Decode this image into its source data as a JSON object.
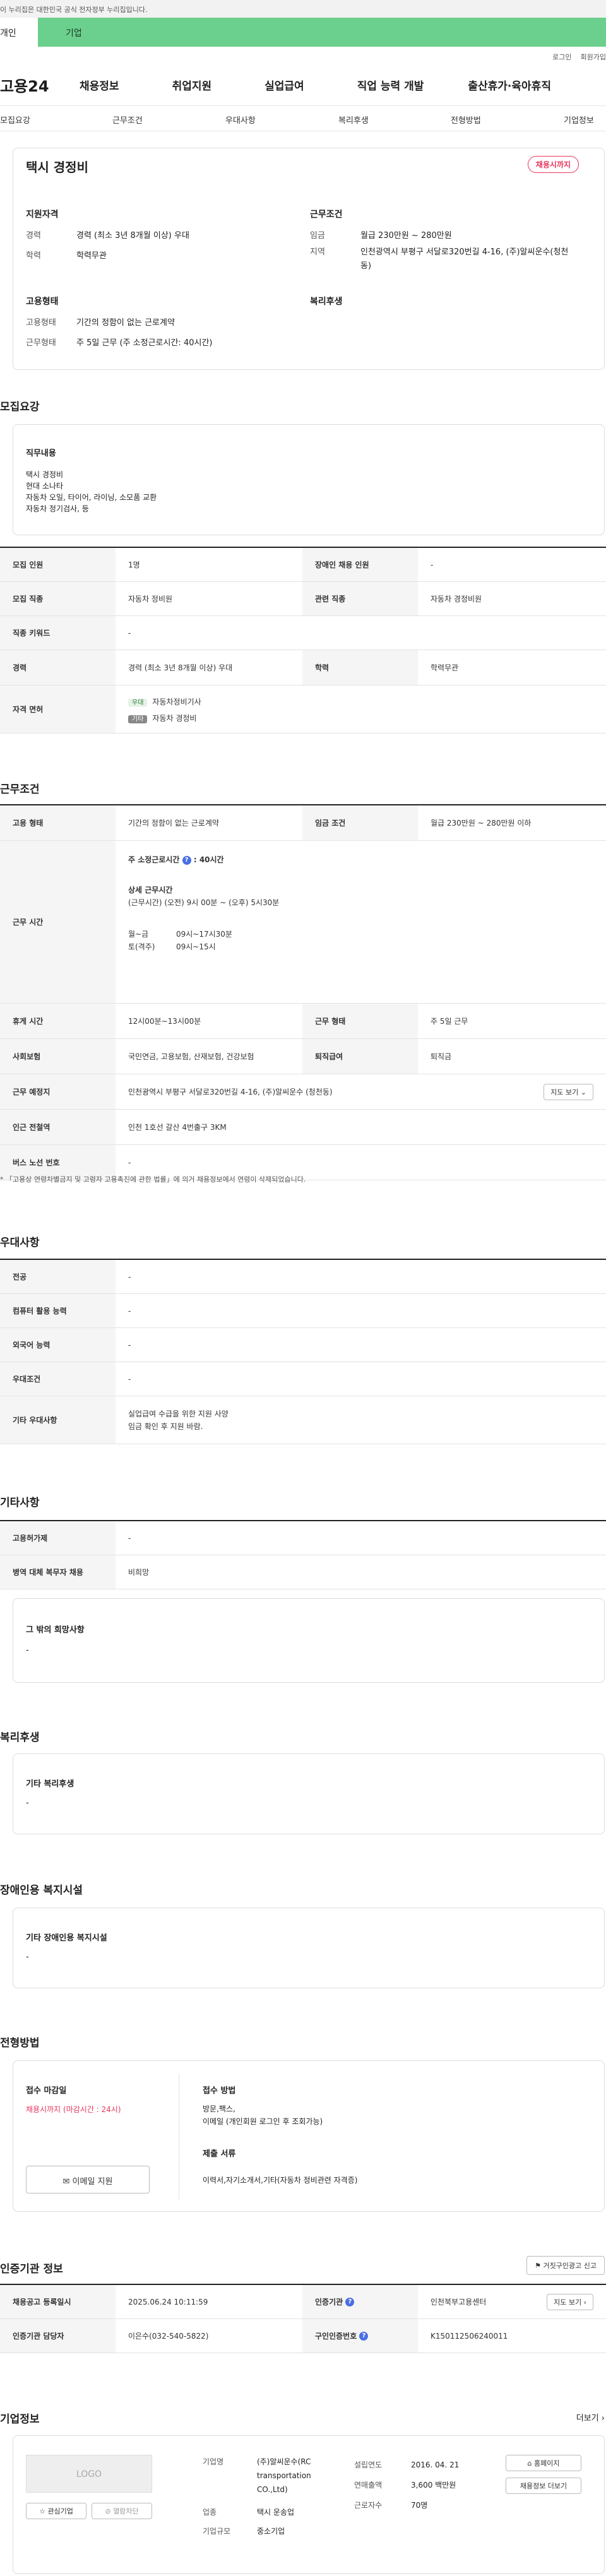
{
  "top": {
    "gov_notice": "이 누리집은 대한민국 공식 전자정부 누리집입니다.",
    "tab_personal": "개인",
    "tab_company": "기업"
  },
  "util": {
    "login": "로그인",
    "join": "회원가입"
  },
  "gnb": {
    "logo": "고용24",
    "menu": [
      "채용정보",
      "취업지원",
      "실업급여",
      "직업 능력 개발",
      "출산휴가·육아휴직"
    ]
  },
  "snb": [
    "모집요강",
    "근무조건",
    "우대사항",
    "복리후생",
    "전형방법",
    "기업정보"
  ],
  "summary": {
    "title": "택시 경정비",
    "status": "채용시까지",
    "qual_head": "지원자격",
    "career_k": "경력",
    "career_v": "경력 (최소 3년 8개월 이상) 우대",
    "edu_k": "학력",
    "edu_v": "학력무관",
    "cond_head": "근무조건",
    "wage_k": "임금",
    "wage_v": "월급 230만원 ~ 280만원",
    "region_k": "지역",
    "region_v": "인천광역시 부평구 서달로320번길 4-16, (주)알씨운수(청천동)",
    "type_head": "고용형태",
    "emp_k": "고용형태",
    "emp_v": "기간의 정함이 없는 근로계약",
    "work_k": "근무형태",
    "work_v": "주 5일 근무 (주 소정근로시간: 40시간)",
    "welfare_head": "복리후생"
  },
  "recruit": {
    "title": "모집요강",
    "duty_head": "직무내용",
    "duty_lines": [
      "택시 경정비",
      "현대 소나타",
      "자동차 오일, 타이어, 라이닝, 소모품 교환",
      "자동차 정기검사, 등"
    ],
    "headcount_k": "모집 인원",
    "headcount_v": "1명",
    "disabled_k": "장애인 채용 인원",
    "disabled_v": "-",
    "job_k": "모집 직종",
    "job_v": "자동차 정비원",
    "rel_k": "관련 직종",
    "rel_v": "자동차 경정비원",
    "kw_k": "직종 키워드",
    "kw_v": "-",
    "career_k": "경력",
    "career_v": "경력 (최소 3년 8개월 이상) 우대",
    "edu_k": "학력",
    "edu_v": "학력무관",
    "lic_k": "자격 면허",
    "lic1_tag": "우대",
    "lic1": "자동차정비기사",
    "lic2_tag": "기타",
    "lic2": "자동차 경정비"
  },
  "cond": {
    "title": "근무조건",
    "emp_k": "고용 형태",
    "emp_v": "기간의 정함이 없는 근로계약",
    "wage_k": "임금 조건",
    "wage_v": "월급 230만원 ~ 280만원 이하",
    "time_k": "근무 시간",
    "weekly": "주 소정근로시간",
    "weekly_v": ": 40시간",
    "detail_head": "상세 근무시간",
    "detail_line": "(근무시간) (오전) 9시 00분 ~ (오후) 5시30분",
    "days1": "월~금",
    "time1": "09시~17시30분",
    "days2": "토(격주)",
    "time2": "09시~15시",
    "break_k": "휴게 시간",
    "break_v": "12시00분~13시00분",
    "form_k": "근무 형태",
    "form_v": "주 5일 근무",
    "ins_k": "사회보험",
    "ins_v": "국민연금, 고용보험, 산재보험, 건강보험",
    "sev_k": "퇴직급여",
    "sev_v": "퇴직금",
    "place_k": "근무 예정지",
    "place_v": "인천광역시 부평구 서달로320번길 4-16, (주)알씨운수 (청천동)",
    "map_btn": "지도 보기",
    "sub_k": "인근 전철역",
    "sub_v": "인천 1호선 갈산 4번출구 3KM",
    "bus_k": "버스 노선 번호",
    "bus_v": "-",
    "note": "* 「고용상 연령차별금지 및 고령자 고용촉진에 관한 법률」에 의거 채용정보에서 연령이 삭제되었습니다."
  },
  "pref": {
    "title": "우대사항",
    "major_k": "전공",
    "major_v": "-",
    "pc_k": "컴퓨터 활용 능력",
    "pc_v": "-",
    "lang_k": "외국어 능력",
    "lang_v": "-",
    "cond_k": "우대조건",
    "cond_v": "-",
    "etc_k": "기타 우대사항",
    "etc_v1": "실업급여 수급을 위한 지원 사양",
    "etc_v2": "임금 확인 후 지원 바람."
  },
  "etc": {
    "title": "기타사항",
    "permit_k": "고용허가제",
    "permit_v": "-",
    "mil_k": "병역 대체 복무자 채용",
    "mil_v": "비희망",
    "hope_head": "그 밖의 희망사항",
    "hope_v": "-"
  },
  "welfare": {
    "title": "복리후생",
    "head": "기타 복리후생",
    "v": "-"
  },
  "dis": {
    "title": "장애인용 복지시설",
    "head": "기타 장애인용 복지시설",
    "v": "-"
  },
  "screen": {
    "title": "전형방법",
    "deadline_head": "접수 마감일",
    "deadline_v": "채용시까지 (마감시간 : 24시)",
    "email_btn": "이메일 지원",
    "method_head": "접수 방법",
    "method_v1": "방문,팩스,",
    "method_v2": "이메일 (개인회원 로그인 후 조회가능)",
    "doc_head": "제출 서류",
    "doc_v": "이력서,자기소개서,기타(자동차 정비관련 자격증)"
  },
  "cert": {
    "title": "인증기관 정보",
    "report_btn": "거짓구인광고 신고",
    "reg_k": "채용공고 등록일시",
    "reg_v": "2025.06.24 10:11:59",
    "org_k": "인증기관",
    "org_v": "인천북부고용센터",
    "map_btn": "지도 보기",
    "mgr_k": "인증기관 담당자",
    "mgr_v": "이은수(032-540-5822)",
    "no_k": "구인인증번호",
    "no_v": "K150112506240011"
  },
  "company": {
    "title": "기업정보",
    "more": "더보기",
    "logo": "LOGO",
    "fav_btn": "관심기업",
    "block_btn": "열람차단",
    "name_k": "기업명",
    "name_v": "(주)알씨운수(RC transportation CO.,Ltd)",
    "ind_k": "업종",
    "ind_v": "택시 운송업",
    "scale_k": "기업규모",
    "scale_v": "중소기업",
    "est_k": "설립연도",
    "est_v": "2016. 04. 21",
    "sales_k": "연매출액",
    "sales_v": "3,600 백만원",
    "emp_k": "근로자수",
    "emp_v": "70명",
    "home_btn": "홈페이지",
    "list_btn": "채용정보 더보기"
  }
}
